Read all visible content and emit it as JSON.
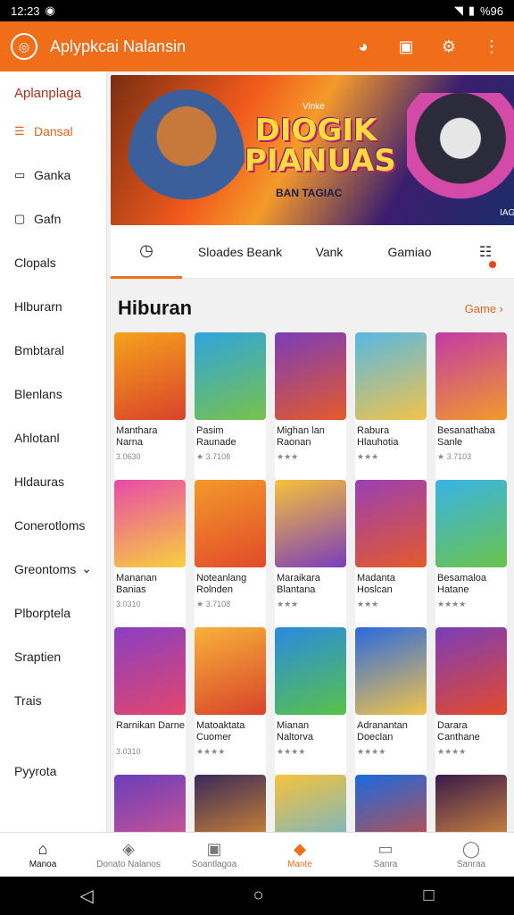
{
  "status": {
    "time": "12:23",
    "battery": "%96"
  },
  "appbar": {
    "title": "Aplypkcai Nalansin"
  },
  "sidebar": {
    "heading": "Aplanplaga",
    "items": [
      {
        "label": "Dansal",
        "icon": "☰",
        "active": true
      },
      {
        "label": "Ganka",
        "icon": "▭"
      },
      {
        "label": "Gafn",
        "icon": "▢"
      },
      {
        "label": "Clopals"
      },
      {
        "label": "Hlburarn"
      },
      {
        "label": "Bmbtaral"
      },
      {
        "label": "Blenlans"
      },
      {
        "label": "Ahlotanl"
      },
      {
        "label": "Hldauras"
      },
      {
        "label": "Conerotloms"
      },
      {
        "label": "Greontoms",
        "chevron": true
      },
      {
        "label": "Plborptela"
      },
      {
        "label": "Sraptien"
      },
      {
        "label": "Trais"
      },
      {
        "label": "Pyyrota",
        "spaced": true
      }
    ]
  },
  "banner": {
    "top": "Vinke",
    "title": "DIOGIK PIANUAS",
    "subtitle": "BAN TAGIAC",
    "corner": "IAGS"
  },
  "tabs": [
    "Sloades Beank",
    "Vank",
    "Gamiao"
  ],
  "section": {
    "title": "Hiburan",
    "more": "Game ›"
  },
  "games": [
    [
      {
        "name": "Manthara Narna",
        "rating": "3.0630",
        "colors": [
          "#f6a21d",
          "#d8432a"
        ]
      },
      {
        "name": "Pasim Raunade",
        "rating": "★ 3.7108",
        "colors": [
          "#2fa4e0",
          "#78c24a"
        ]
      },
      {
        "name": "Mighan lan Raonan",
        "rating": "★★★",
        "colors": [
          "#7a3dbb",
          "#e45a2a"
        ]
      },
      {
        "name": "Rabura Hlauhotia",
        "rating": "★★★",
        "colors": [
          "#56b8e6",
          "#f2c34a"
        ]
      },
      {
        "name": "Besanathaba Sanle",
        "rating": "★ 3.7103",
        "colors": [
          "#c23aa5",
          "#f29a2a"
        ]
      }
    ],
    [
      {
        "name": "Mananan Banias",
        "rating": "3.0310",
        "colors": [
          "#e84aa8",
          "#f7d13c"
        ]
      },
      {
        "name": "Noteanlang Rolnden",
        "rating": "★ 3.7108",
        "colors": [
          "#f29a2a",
          "#e24a2a"
        ]
      },
      {
        "name": "Maraikara Blantana",
        "rating": "★★★",
        "colors": [
          "#f7c23a",
          "#7a3dbb"
        ]
      },
      {
        "name": "Madanta Hoslcan",
        "rating": "★★★",
        "colors": [
          "#9a3fb4",
          "#e45a2a"
        ]
      },
      {
        "name": "Besamaloa Hatane",
        "rating": "★★★★",
        "colors": [
          "#38b4e6",
          "#6bc24a"
        ]
      }
    ],
    [
      {
        "name": "Rarnikan Darne",
        "rating": "3.0310",
        "colors": [
          "#8a3fc4",
          "#e2466c"
        ]
      },
      {
        "name": "Matoaktata Cuomer",
        "rating": "★★★★",
        "colors": [
          "#f7b23a",
          "#d8432a"
        ]
      },
      {
        "name": "Mianan Naltorva",
        "rating": "★★★★",
        "colors": [
          "#2a8ae0",
          "#58c24a"
        ]
      },
      {
        "name": "Adranantan Doeclan",
        "rating": "★★★★",
        "colors": [
          "#2a6ae0",
          "#f2c34a"
        ]
      },
      {
        "name": "Darara Canthane",
        "rating": "★★★★",
        "colors": [
          "#7a3dbb",
          "#e44a2a"
        ]
      }
    ],
    [
      {
        "name": "",
        "rating": "",
        "colors": [
          "#6a3dbb",
          "#e45a8a"
        ]
      },
      {
        "name": "",
        "rating": "",
        "colors": [
          "#3a2a5a",
          "#f29a2a"
        ]
      },
      {
        "name": "",
        "rating": "",
        "colors": [
          "#f7c23a",
          "#58b4e6"
        ]
      },
      {
        "name": "",
        "rating": "",
        "colors": [
          "#1a6ae0",
          "#e24a2a"
        ]
      },
      {
        "name": "",
        "rating": "",
        "colors": [
          "#3a1a4a",
          "#f2a23a"
        ]
      }
    ]
  ],
  "bottom_nav": [
    {
      "label": "Manoa",
      "icon": "⌂",
      "state": "home"
    },
    {
      "label": "Donato Nalanos",
      "icon": "◈"
    },
    {
      "label": "Soantlagoa",
      "icon": "▣"
    },
    {
      "label": "Mante",
      "icon": "◆",
      "state": "active"
    },
    {
      "label": "Sanra",
      "icon": "▭"
    },
    {
      "label": "Sanraa",
      "icon": "◯"
    }
  ]
}
